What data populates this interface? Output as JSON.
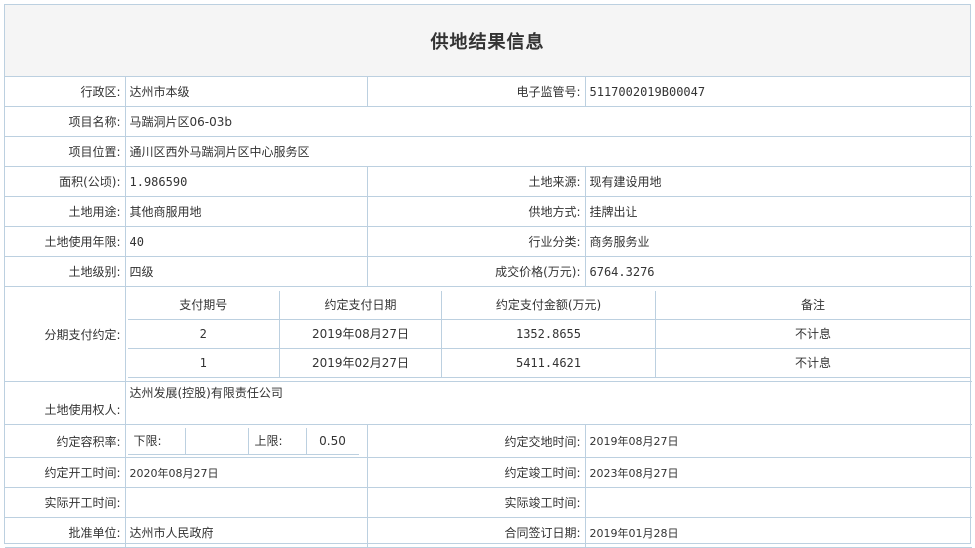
{
  "title": "供地结果信息",
  "rows": {
    "admin_region": {
      "label": "行政区:",
      "value": "达州市本级"
    },
    "e_supervision_no": {
      "label": "电子监管号:",
      "value": "5117002019B00047"
    },
    "project_name": {
      "label": "项目名称:",
      "value": "马踹洞片区06-03b"
    },
    "project_location": {
      "label": "项目位置:",
      "value": "通川区西外马踹洞片区中心服务区"
    },
    "area": {
      "label": "面积(公顷):",
      "value": "1.986590"
    },
    "land_source": {
      "label": "土地来源:",
      "value": "现有建设用地"
    },
    "land_use": {
      "label": "土地用途:",
      "value": "其他商服用地"
    },
    "supply_method": {
      "label": "供地方式:",
      "value": "挂牌出让"
    },
    "use_years": {
      "label": "土地使用年限:",
      "value": "40"
    },
    "industry": {
      "label": "行业分类:",
      "value": "商务服务业"
    },
    "land_grade": {
      "label": "土地级别:",
      "value": "四级"
    },
    "deal_price": {
      "label": "成交价格(万元):",
      "value": "6764.3276"
    },
    "installments": {
      "label": "分期支付约定:",
      "headers": [
        "支付期号",
        "约定支付日期",
        "约定支付金额(万元)",
        "备注"
      ],
      "items": [
        {
          "no": "2",
          "date": "2019年08月27日",
          "amount": "1352.8655",
          "note": "不计息"
        },
        {
          "no": "1",
          "date": "2019年02月27日",
          "amount": "5411.4621",
          "note": "不计息"
        }
      ]
    },
    "land_user": {
      "label": "土地使用权人:",
      "value": "达州发展(控股)有限责任公司"
    },
    "plot_ratio": {
      "label": "约定容积率:",
      "lower_label": "下限:",
      "lower_value": "",
      "upper_label": "上限:",
      "upper_value": "0.50"
    },
    "handover_time": {
      "label": "约定交地时间:",
      "value": "2019年08月27日"
    },
    "start_time": {
      "label": "约定开工时间:",
      "value": "2020年08月27日"
    },
    "completion_time": {
      "label": "约定竣工时间:",
      "value": "2023年08月27日"
    },
    "actual_start": {
      "label": "实际开工时间:",
      "value": ""
    },
    "actual_completion": {
      "label": "实际竣工时间:",
      "value": ""
    },
    "approval_unit": {
      "label": "批准单位:",
      "value": "达州市人民政府"
    },
    "contract_date": {
      "label": "合同签订日期:",
      "value": "2019年01月28日"
    }
  }
}
